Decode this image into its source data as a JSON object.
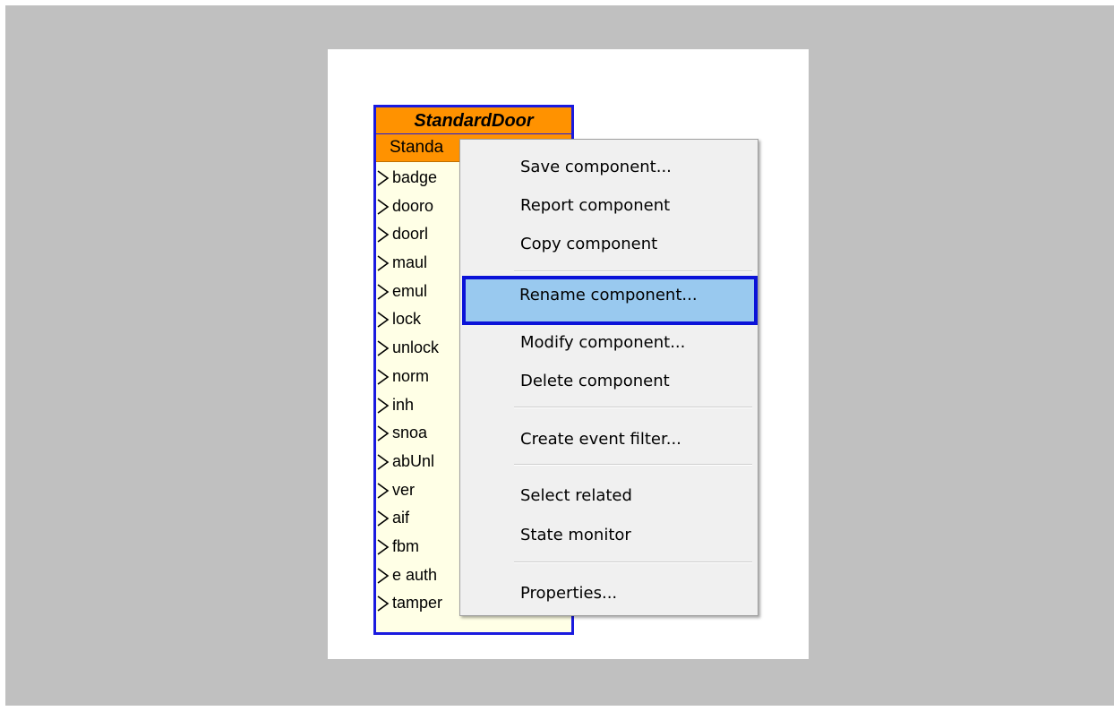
{
  "component": {
    "title": "StandardDoor",
    "type_label": "Standa",
    "ports": [
      "badge",
      "dooro",
      "doorl",
      "maul",
      "emul",
      "lock",
      "unlock",
      "norm",
      "inh",
      "snoa",
      "abUnl",
      "ver",
      "aif",
      "fbm",
      "e auth",
      "tamper"
    ],
    "colors": {
      "header": "#ff9200",
      "border": "#1a1adf",
      "body": "#ffffe6"
    }
  },
  "context_menu": {
    "highlighted_index": 3,
    "items": [
      "Save component...",
      "Report component",
      "Copy component",
      "Rename component...",
      "Modify component...",
      "Delete component",
      "Create event filter...",
      "Select related",
      "State monitor",
      "Properties..."
    ],
    "colors": {
      "highlight": "#99c9ef",
      "highlight_border": "#0a12d8"
    }
  }
}
